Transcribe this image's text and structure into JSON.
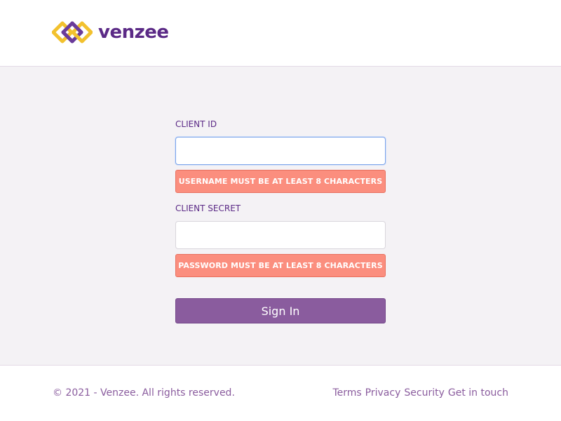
{
  "brand": {
    "name": "venzee",
    "colors": {
      "purple": "#5b2a86",
      "gold": "#f2c12e",
      "accent": "#8a5c9e",
      "error_bg": "#fb8e7e"
    }
  },
  "login_form": {
    "client_id": {
      "label": "CLIENT ID",
      "value": "",
      "placeholder": "",
      "error": "USERNAME MUST BE AT LEAST 8 CHARACTERS"
    },
    "client_secret": {
      "label": "CLIENT SECRET",
      "value": "",
      "placeholder": "",
      "error": "PASSWORD MUST BE AT LEAST 8 CHARACTERS"
    },
    "submit_label": "Sign In"
  },
  "footer": {
    "copyright": "© 2021 - Venzee. All rights reserved.",
    "links": [
      {
        "label": "Terms"
      },
      {
        "label": "Privacy"
      },
      {
        "label": "Security"
      },
      {
        "label": "Get in touch"
      }
    ]
  },
  "icons": {
    "logo": "venzee-logo-icon"
  }
}
